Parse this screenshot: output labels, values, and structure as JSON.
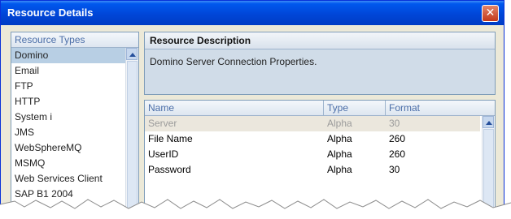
{
  "window": {
    "title": "Resource Details"
  },
  "resource_types": {
    "header": "Resource Types",
    "items": [
      "Domino",
      "Email",
      "FTP",
      "HTTP",
      "System i",
      "JMS",
      "WebSphereMQ",
      "MSMQ",
      "Web Services Client",
      "SAP B1 2004"
    ],
    "selected_index": 0
  },
  "description": {
    "header": "Resource Description",
    "text": "Domino Server Connection Properties."
  },
  "properties_table": {
    "columns": [
      "Name",
      "Type",
      "Format"
    ],
    "rows": [
      {
        "name": "Server",
        "type": "Alpha",
        "format": "30"
      },
      {
        "name": "File Name",
        "type": "Alpha",
        "format": "260"
      },
      {
        "name": "UserID",
        "type": "Alpha",
        "format": "260"
      },
      {
        "name": "Password",
        "type": "Alpha",
        "format": "30"
      }
    ]
  },
  "colors": {
    "titlebar": "#0058ee",
    "selection": "#b8cfe4",
    "panel_bg": "#d0dce8",
    "header_text": "#4b6ea8"
  },
  "icons": [
    "close-icon",
    "scroll-up-icon"
  ]
}
